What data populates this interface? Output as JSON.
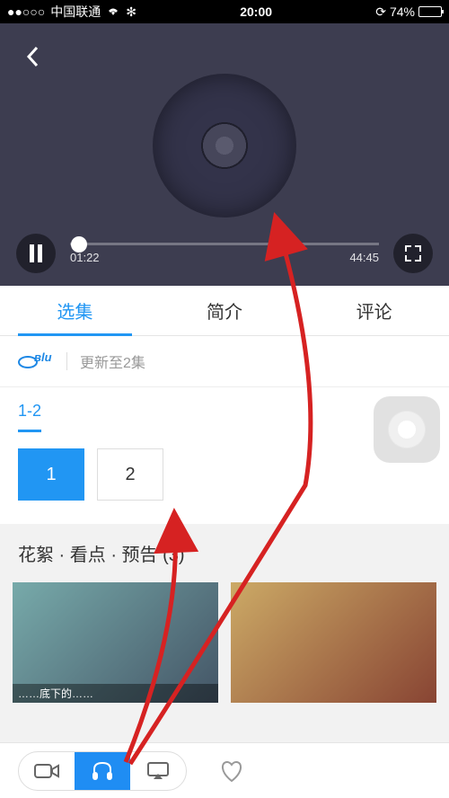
{
  "status": {
    "carrier": "中国联通",
    "time": "20:00",
    "battery_pct": "74%"
  },
  "player": {
    "current_time": "01:22",
    "duration": "44:45"
  },
  "tabs": {
    "episodes": "选集",
    "summary": "简介",
    "comments": "评论"
  },
  "subhead": {
    "source": "Blu-ray",
    "update_status": "更新至2集"
  },
  "range": {
    "r1": "1-2"
  },
  "episodes": {
    "ep1": "1",
    "ep2": "2"
  },
  "extras": {
    "title": "花絮 · 看点 · 预告 (3)",
    "thumb1_caption": "……底下的……"
  }
}
